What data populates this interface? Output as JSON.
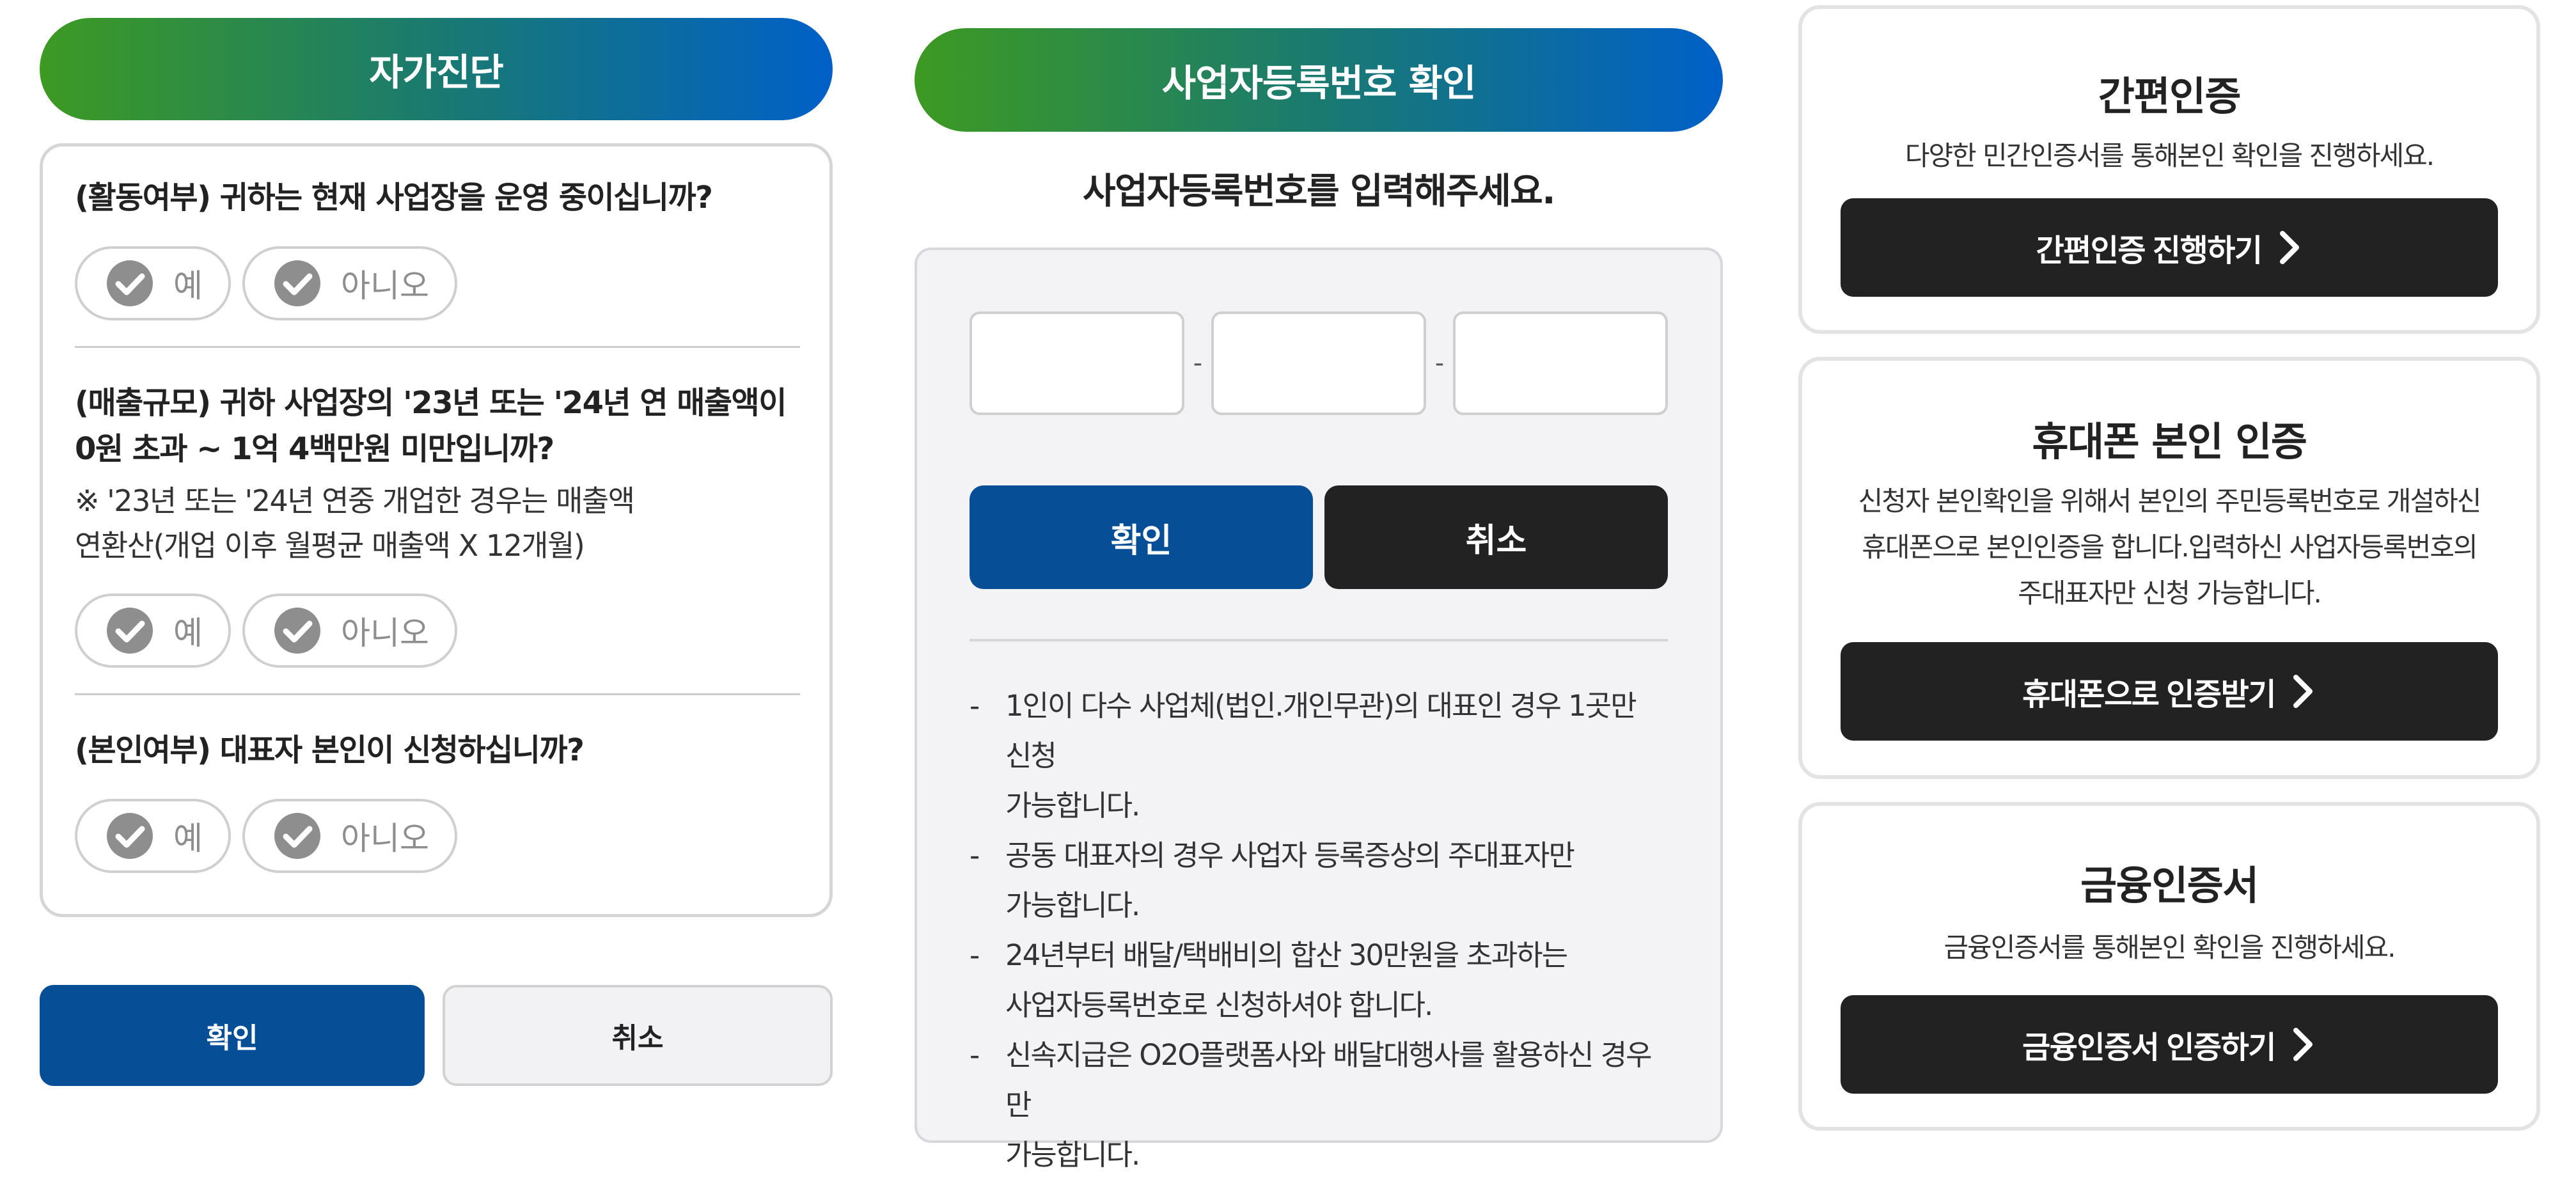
{
  "self_diagnosis": {
    "title": "자가진단",
    "yes_label": "예",
    "no_label": "아니오",
    "questions": [
      {
        "text": "(활동여부) 귀하는 현재 사업장을 운영 중이십니까?"
      },
      {
        "text_line1": "(매출규모) 귀하 사업장의 '23년 또는 '24년 연 매출액이",
        "text_line2": "0원 초과 ~ 1억 4백만원 미만입니까?",
        "note_line1": "※ '23년 또는 '24년 연중 개업한 경우는 매출액",
        "note_line2": "연환산(개업 이후 월평균 매출액 X 12개월)"
      },
      {
        "text": "(본인여부) 대표자 본인이 신청하십니까?"
      }
    ],
    "confirm_label": "확인",
    "cancel_label": "취소"
  },
  "business_number": {
    "title": "사업자등록번호 확인",
    "subtitle": "사업자등록번호를 입력해주세요.",
    "dash": "-",
    "confirm_label": "확인",
    "cancel_label": "취소",
    "notes": [
      {
        "line1": "1인이 다수 사업체(법인.개인무관)의 대표인 경우 1곳만 신청",
        "line2": "가능합니다."
      },
      {
        "line1": "공동 대표자의 경우 사업자 등록증상의 주대표자만",
        "line2": "가능합니다."
      },
      {
        "line1": "24년부터 배달/택배비의 합산 30만원을 초과하는",
        "line2": "사업자등록번호로 신청하셔야 합니다."
      },
      {
        "line1": "신속지급은 O2O플랫폼사와 배달대행사를 활용하신 경우만",
        "line2": "가능합니다."
      }
    ]
  },
  "auth": {
    "simple": {
      "title": "간편인증",
      "desc": "다양한 민간인증서를 통해본인 확인을 진행하세요.",
      "button": "간편인증 진행하기"
    },
    "phone": {
      "title": "휴대폰 본인 인증",
      "desc_line1": "신청자 본인확인을 위해서 본인의 주민등록번호로 개설하신",
      "desc_line2": "휴대폰으로 본인인증을 합니다.입력하신 사업자등록번호의",
      "desc_line3": "주대표자만 신청 가능합니다.",
      "button": "휴대폰으로 인증받기"
    },
    "financial": {
      "title": "금융인증서",
      "desc": "금융인증서를 통해본인 확인을 진행하세요.",
      "button": "금융인증서 인증하기"
    }
  },
  "icons": {
    "check": "check-circle-icon",
    "chevron": "chevron-right-icon"
  },
  "colors": {
    "header_gradient_start": "#3d9a22",
    "header_gradient_end": "#0060c8",
    "primary_blue": "#064f96",
    "dark_button": "#222222",
    "check_gray": "#8e8e8e"
  }
}
